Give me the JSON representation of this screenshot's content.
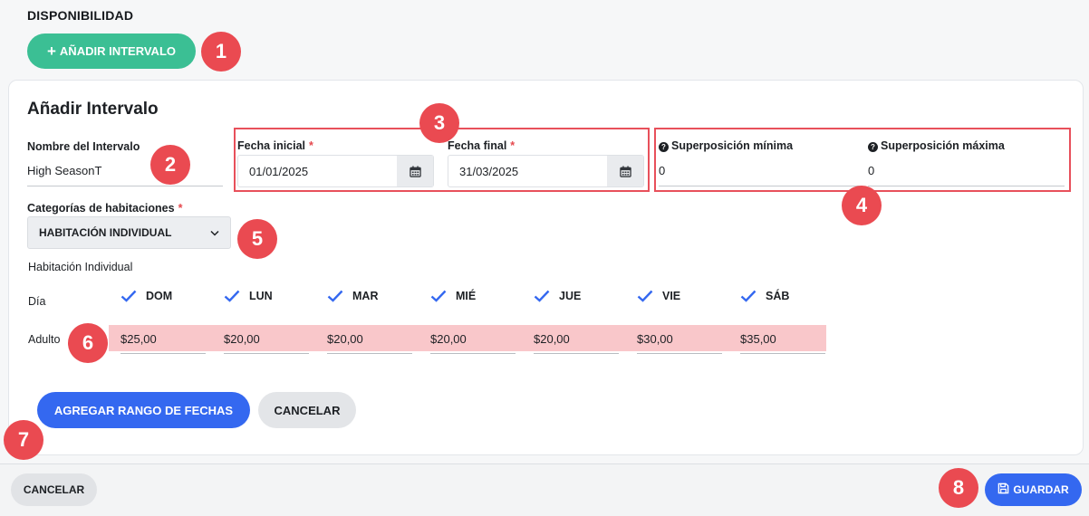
{
  "section_title": "DISPONIBILIDAD",
  "add_interval_button": {
    "icon": "plus-icon",
    "label": "AÑADIR INTERVALO"
  },
  "card": {
    "title": "Añadir Intervalo",
    "interval_name": {
      "label": "Nombre del Intervalo",
      "value": "High SeasonT"
    },
    "start_date": {
      "label": "Fecha inicial",
      "required_mark": "*",
      "value": "01/01/2025",
      "icon": "calendar-icon"
    },
    "end_date": {
      "label": "Fecha final",
      "required_mark": "*",
      "value": "31/03/2025",
      "icon": "calendar-icon"
    },
    "min_overlap": {
      "icon": "question-circle-icon",
      "label": "Superposición mínima",
      "value": "0"
    },
    "max_overlap": {
      "icon": "question-circle-icon",
      "label": "Superposición máxima",
      "value": "0"
    },
    "room_categories": {
      "label": "Categorías de habitaciones",
      "required_mark": "*",
      "selected": "HABITACIÓN INDIVIDUAL",
      "icon": "chevron-down-icon"
    },
    "room_name": "Habitación Individual",
    "day_row_label": "Día",
    "adult_row_label": "Adulto",
    "days": [
      {
        "label": "DOM",
        "checked": true,
        "adult_price": "$25,00"
      },
      {
        "label": "LUN",
        "checked": true,
        "adult_price": "$20,00"
      },
      {
        "label": "MAR",
        "checked": true,
        "adult_price": "$20,00"
      },
      {
        "label": "MIÉ",
        "checked": true,
        "adult_price": "$20,00"
      },
      {
        "label": "JUE",
        "checked": true,
        "adult_price": "$20,00"
      },
      {
        "label": "VIE",
        "checked": true,
        "adult_price": "$30,00"
      },
      {
        "label": "SÁB",
        "checked": true,
        "adult_price": "$35,00"
      }
    ],
    "add_range_button": "AGREGAR RANGO DE FECHAS",
    "cancel_button": "CANCELAR"
  },
  "footer": {
    "cancel_button": "CANCELAR",
    "save_button": {
      "icon": "save-icon",
      "label": "GUARDAR"
    }
  },
  "annotations": [
    "1",
    "2",
    "3",
    "4",
    "5",
    "6",
    "7",
    "8"
  ],
  "colors": {
    "accent_green": "#3bbf94",
    "primary_blue": "#3468f0",
    "annotation_red": "#ea4a51",
    "price_highlight": "#f9c7ca"
  }
}
